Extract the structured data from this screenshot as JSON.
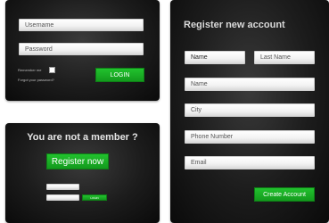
{
  "login_form": {
    "username_placeholder": "Username",
    "password_placeholder": "Password",
    "remember_label": "Remember me",
    "forgot_link": "Forgot your password?",
    "login_button": "LOGIN"
  },
  "member_prompt": {
    "heading": "You are not a member ?",
    "register_button": "Register now",
    "mini_login_button": "LOGIN"
  },
  "register_form": {
    "title": "Register new account",
    "first_name_placeholder": "Name",
    "last_name_placeholder": "Last Name",
    "name_placeholder": "Name",
    "city_placeholder": "City",
    "phone_placeholder": "Phone Number",
    "email_placeholder": "Email",
    "submit_button": "Create Account"
  },
  "colors": {
    "accent_green": "#1aae25",
    "panel_bg": "#1c1c1c"
  }
}
